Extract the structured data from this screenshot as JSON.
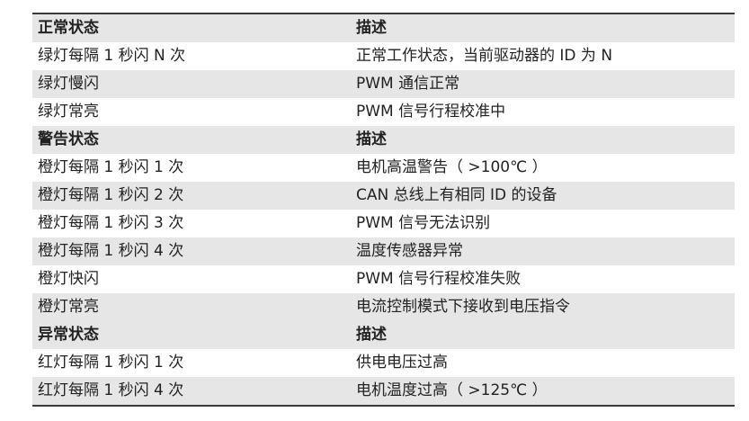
{
  "table": {
    "sections": [
      {
        "header": {
          "status": "正常状态",
          "desc": "描述"
        },
        "rows": [
          {
            "status": "绿灯每隔 1 秒闪 N 次",
            "desc": "正常工作状态，当前驱动器的 ID 为 N"
          },
          {
            "status": "绿灯慢闪",
            "desc": "PWM 通信正常"
          },
          {
            "status": "绿灯常亮",
            "desc": "PWM 信号行程校准中"
          }
        ]
      },
      {
        "header": {
          "status": "警告状态",
          "desc": "描述"
        },
        "rows": [
          {
            "status": "橙灯每隔 1 秒闪 1 次",
            "desc": "电机高温警告（ >100℃ ）"
          },
          {
            "status": "橙灯每隔 1 秒闪 2 次",
            "desc": "CAN 总线上有相同 ID 的设备"
          },
          {
            "status": "橙灯每隔 1 秒闪 3 次",
            "desc": "PWM 信号无法识别"
          },
          {
            "status": "橙灯每隔 1 秒闪 4 次",
            "desc": "温度传感器异常"
          },
          {
            "status": "橙灯快闪",
            "desc": "PWM 信号行程校准失败"
          },
          {
            "status": "橙灯常亮",
            "desc": "电流控制模式下接收到电压指令"
          }
        ]
      },
      {
        "header": {
          "status": "异常状态",
          "desc": "描述"
        },
        "rows": [
          {
            "status": "红灯每隔 1 秒闪 1 次",
            "desc": "供电电压过高"
          },
          {
            "status": "红灯每隔 1 秒闪 4 次",
            "desc": "电机温度过高（ >125℃ ）"
          }
        ]
      }
    ]
  }
}
